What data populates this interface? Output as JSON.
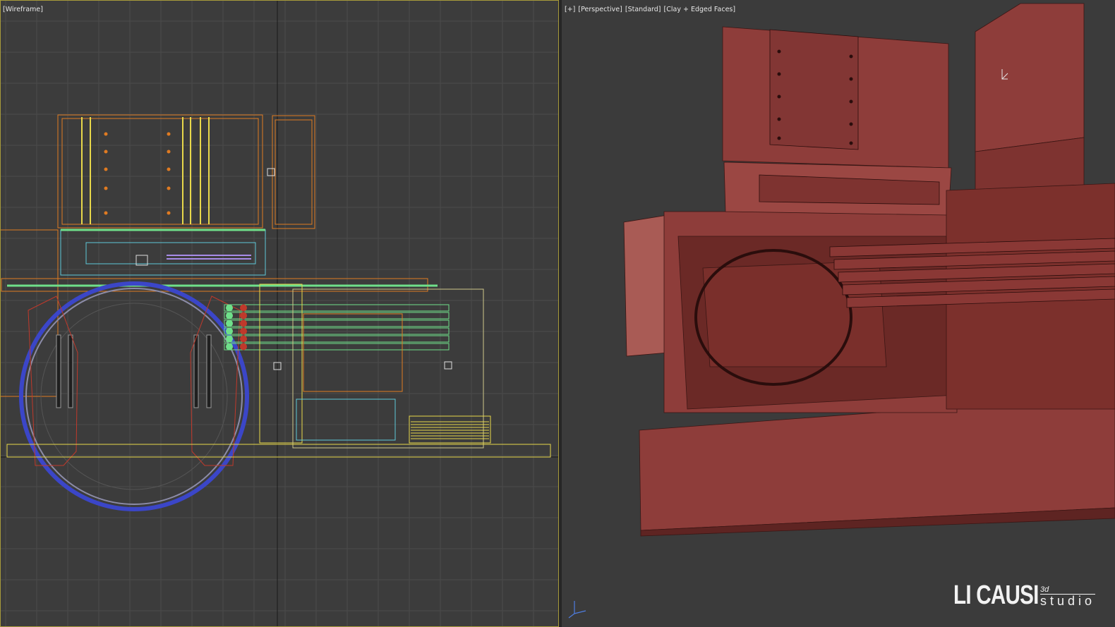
{
  "viewports": {
    "left": {
      "label_parts": [
        "[Wireframe]"
      ],
      "name": "front-wireframe-viewport"
    },
    "right": {
      "label_parts": [
        "[+]",
        "[Perspective]",
        "[Standard]",
        "[Clay + Edged Faces]"
      ],
      "name": "perspective-viewport"
    }
  },
  "logo": {
    "main": "LI CAUSI",
    "superscript": "3d",
    "sub": "studio"
  },
  "colors": {
    "viewport_bg": "#3c3c3c",
    "grid": "#4b4b4b",
    "active_border": "#a79a3a",
    "clay": "#8e3d3a",
    "clay_dark": "#5e2422",
    "clay_light": "#a95b55",
    "wire_orange": "#e07b22",
    "wire_yellow": "#e8d84a",
    "wire_cyan": "#5ec8d8",
    "wire_green": "#6fe08a",
    "wire_blue": "#3b46c8",
    "wire_red": "#c0392b"
  },
  "icons": [
    "axis-gizmo-icon",
    "cursor-icon"
  ]
}
